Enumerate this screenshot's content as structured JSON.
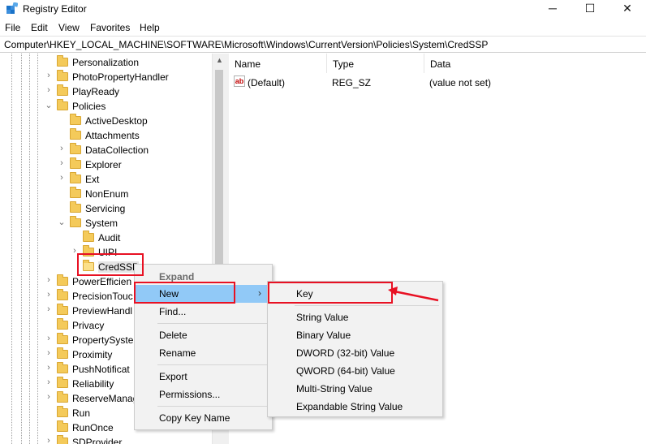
{
  "window": {
    "title": "Registry Editor",
    "controls": {
      "minimize": "─",
      "maximize": "☐",
      "close": "✕"
    }
  },
  "menubar": [
    "File",
    "Edit",
    "View",
    "Favorites",
    "Help"
  ],
  "address": "Computer\\HKEY_LOCAL_MACHINE\\SOFTWARE\\Microsoft\\Windows\\CurrentVersion\\Policies\\System\\CredSSP",
  "tree": [
    {
      "label": "Personalization",
      "level": 0,
      "expander": ""
    },
    {
      "label": "PhotoPropertyHandler",
      "level": 0,
      "expander": "closed"
    },
    {
      "label": "PlayReady",
      "level": 0,
      "expander": "closed"
    },
    {
      "label": "Policies",
      "level": 0,
      "expander": "open"
    },
    {
      "label": "ActiveDesktop",
      "level": 1,
      "expander": ""
    },
    {
      "label": "Attachments",
      "level": 1,
      "expander": ""
    },
    {
      "label": "DataCollection",
      "level": 1,
      "expander": "closed"
    },
    {
      "label": "Explorer",
      "level": 1,
      "expander": "closed"
    },
    {
      "label": "Ext",
      "level": 1,
      "expander": "closed"
    },
    {
      "label": "NonEnum",
      "level": 1,
      "expander": ""
    },
    {
      "label": "Servicing",
      "level": 1,
      "expander": ""
    },
    {
      "label": "System",
      "level": 1,
      "expander": "open"
    },
    {
      "label": "Audit",
      "level": 2,
      "expander": ""
    },
    {
      "label": "UIPI",
      "level": 2,
      "expander": "closed"
    },
    {
      "label": "CredSSP",
      "level": 2,
      "expander": "",
      "selected": true
    },
    {
      "label": "PowerEfficien",
      "level": 0,
      "expander": "closed"
    },
    {
      "label": "PrecisionTouc",
      "level": 0,
      "expander": "closed"
    },
    {
      "label": "PreviewHandl",
      "level": 0,
      "expander": "closed"
    },
    {
      "label": "Privacy",
      "level": 0,
      "expander": ""
    },
    {
      "label": "PropertySyste",
      "level": 0,
      "expander": "closed"
    },
    {
      "label": "Proximity",
      "level": 0,
      "expander": "closed"
    },
    {
      "label": "PushNotificat",
      "level": 0,
      "expander": "closed"
    },
    {
      "label": "Reliability",
      "level": 0,
      "expander": "closed"
    },
    {
      "label": "ReserveManag",
      "level": 0,
      "expander": "closed"
    },
    {
      "label": "Run",
      "level": 0,
      "expander": ""
    },
    {
      "label": "RunOnce",
      "level": 0,
      "expander": ""
    },
    {
      "label": "SDProvider",
      "level": 0,
      "expander": "closed"
    }
  ],
  "listview": {
    "columns": [
      "Name",
      "Type",
      "Data"
    ],
    "rows": [
      {
        "icon": "ab",
        "name": "(Default)",
        "type": "REG_SZ",
        "data": "(value not set)"
      }
    ]
  },
  "context_menu": {
    "expand": "Expand",
    "new": "New",
    "submenu_arrow": "›",
    "find": "Find...",
    "delete": "Delete",
    "rename": "Rename",
    "export": "Export",
    "permissions": "Permissions...",
    "copy_key_name": "Copy Key Name"
  },
  "submenu": [
    "Key",
    "String Value",
    "Binary Value",
    "DWORD (32-bit) Value",
    "QWORD (64-bit) Value",
    "Multi-String Value",
    "Expandable String Value"
  ],
  "colors": {
    "highlight_outline": "#e81123",
    "menu_hover": "#91c9f7",
    "folder": "#f4ca5a"
  }
}
